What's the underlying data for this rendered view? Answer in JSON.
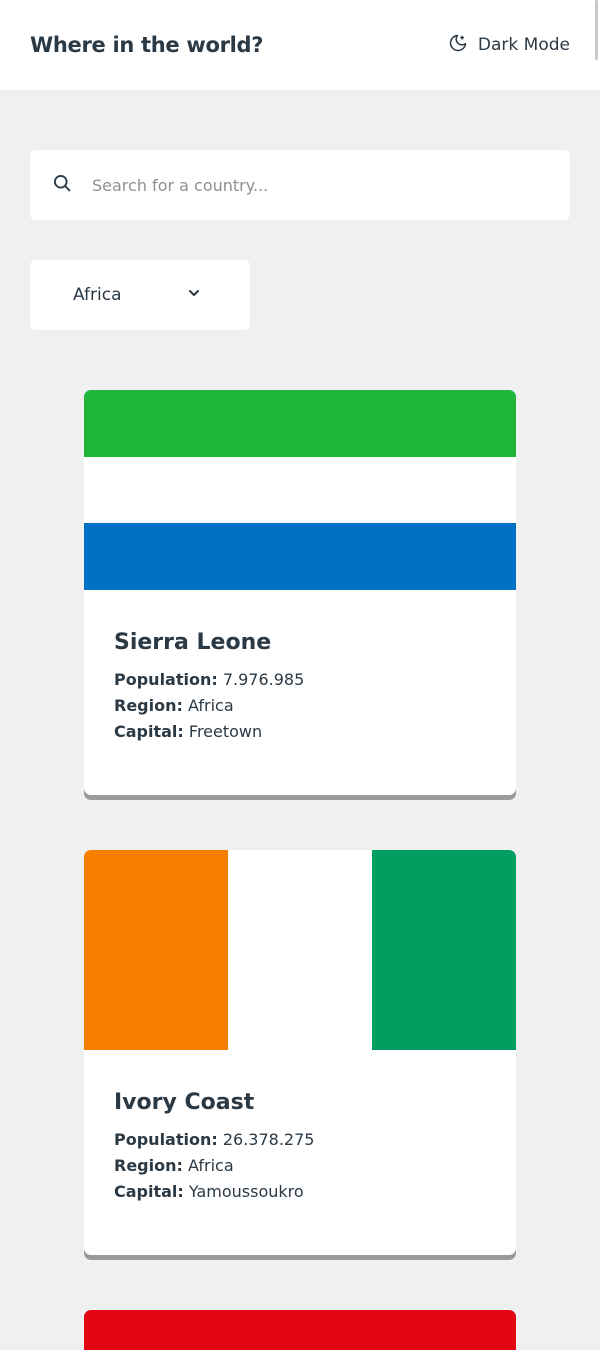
{
  "header": {
    "title": "Where in the world?",
    "mode_label": "Dark Mode",
    "mode_icon": "moon-icon"
  },
  "search": {
    "placeholder": "Search for a country...",
    "value": "",
    "icon": "search-icon"
  },
  "filter": {
    "selected": "Africa",
    "icon": "chevron-down-icon"
  },
  "labels": {
    "population": "Population:",
    "region": "Region:",
    "capital": "Capital:"
  },
  "countries": [
    {
      "name": "Sierra Leone",
      "population": "7.976.985",
      "region": "Africa",
      "capital": "Freetown",
      "flag": {
        "orientation": "horizontal",
        "colors": [
          "#1eb53a",
          "#ffffff",
          "#0072c6"
        ]
      }
    },
    {
      "name": "Ivory Coast",
      "population": "26.378.275",
      "region": "Africa",
      "capital": "Yamoussoukro",
      "flag": {
        "orientation": "vertical",
        "colors": [
          "#f77f00",
          "#ffffff",
          "#009e60"
        ]
      }
    },
    {
      "flag": {
        "orientation": "horizontal",
        "colors": [
          "#e30613"
        ]
      }
    }
  ]
}
